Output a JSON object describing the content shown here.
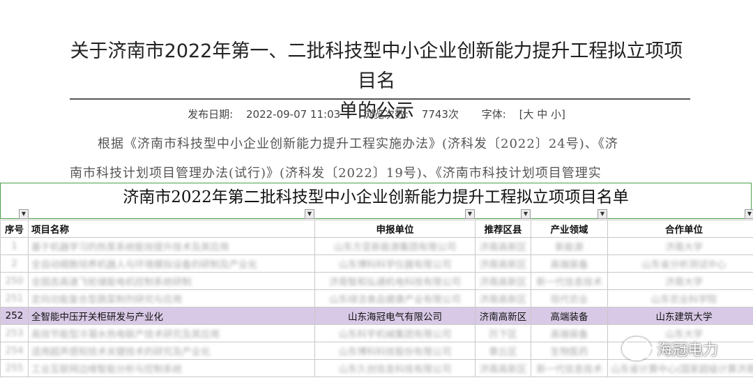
{
  "article": {
    "title_line1": "关于济南市2022年第一、二批科技型中小企业创新能力提升工程拟立项项目名",
    "title_line2": "单的公示",
    "publish_label": "发布日期:",
    "publish_date": "2022-09-07 11:03",
    "views_label": "浏览次数:",
    "views": "7743次",
    "font_label": "字体:",
    "font_options": "[大 中 小]",
    "para_line1": "根据《济南市科技型中小企业创新能力提升工程实施办法》(济科发〔2022〕24号)、《济",
    "para_line2": "南市科技计划项目管理办法(试行)》(济科发〔2022〕19号)、《济南市科技计划项目管理实"
  },
  "sheet": {
    "title": "济南市2022年第二批科技型中小企业创新能力提升工程拟立项项目名单",
    "headers": [
      "序号",
      "项目名称",
      "申报单位",
      "推荐区县",
      "产业领域",
      "合作单位"
    ],
    "rows": [
      {
        "no": "1",
        "name": "基于机器学习的热泵系统能效提升技术及其应用",
        "unit": "山东方亚新能源集团有限公司",
        "county": "济南高新区",
        "field": "新能源",
        "partner": "济南大学",
        "blurred": true
      },
      {
        "no": "2",
        "name": "全自动细胞培养机器人与环境模拟设备的研制及产业化",
        "unit": "山东博科科学仪器有限公司",
        "county": "济南高新区",
        "field": "高端装备",
        "partner": "山东省分析测试中心",
        "blurred": true
      },
      {
        "no": "250",
        "name": "全固态高速飞轮储能电机控制系统研制",
        "unit": "济南智和弘通机电科技有限公司",
        "county": "济南高新区",
        "field": "新一代信息技术",
        "partner": "济南大学",
        "blurred": true
      },
      {
        "no": "251",
        "name": "定向功能复合型蔬菜制剂研究与应用",
        "unit": "山东绿洁食品健康产业有限公司",
        "county": "济南高新区",
        "field": "现代农业",
        "partner": "山东农业科学院",
        "blurred": true
      },
      {
        "no": "252",
        "name": "全智能中压开关柜研发与产业化",
        "unit": "山东海冠电气有限公司",
        "county": "济南高新区",
        "field": "高端装备",
        "partner": "山东建筑大学",
        "blurred": false
      },
      {
        "no": "253",
        "name": "高效节能型冷凝水热电联产技术研究及其应用",
        "unit": "山东科宇机械集团有限公司",
        "county": "历下区",
        "field": "高端装备",
        "partner": "山东大学",
        "blurred": true
      },
      {
        "no": "254",
        "name": "适用超声感知技术关键技术的研究及产业化",
        "unit": "山东博科科技股份有限公司",
        "county": "章丘区",
        "field": "生物医药",
        "partner": "山东大学",
        "blurred": true
      },
      {
        "no": "255",
        "name": "工业互联网边缘智能分析与控制系统",
        "unit": "山东久创信息科技有限公司",
        "county": "济南高新区",
        "field": "新一代信息技术",
        "partner": "山东省计算中心(国家超级计算济南中心)",
        "blurred": true
      }
    ]
  },
  "watermark": {
    "text": "海冠电力",
    "icon": "wechat-icon"
  }
}
